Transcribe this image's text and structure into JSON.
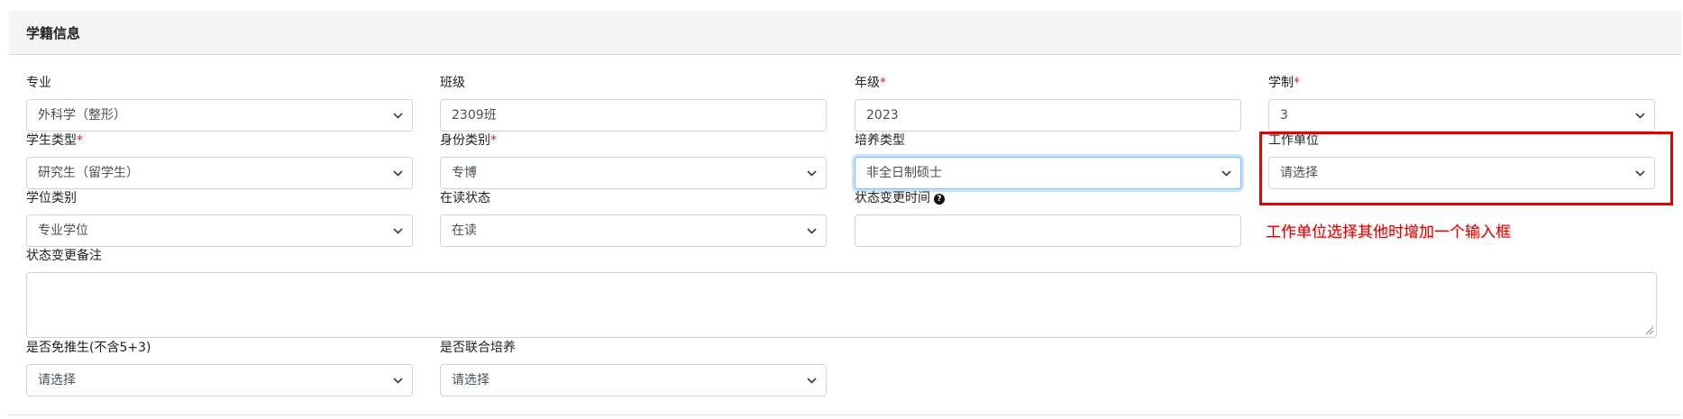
{
  "panel": {
    "title": "学籍信息"
  },
  "fields": {
    "major": {
      "label": "专业",
      "value": "外科学（整形）"
    },
    "class": {
      "label": "班级",
      "value": "2309班"
    },
    "grade": {
      "label": "年级",
      "required": "*",
      "value": "2023"
    },
    "duration": {
      "label": "学制",
      "required": "*",
      "value": "3"
    },
    "student_type": {
      "label": "学生类型",
      "required": "*",
      "value": "研究生（留学生）"
    },
    "identity_type": {
      "label": "身份类别",
      "required": "*",
      "value": "专博"
    },
    "training_type": {
      "label": "培养类型",
      "value": "非全日制硕士"
    },
    "work_unit": {
      "label": "工作单位",
      "value": "请选择"
    },
    "degree_type": {
      "label": "学位类别",
      "value": "专业学位"
    },
    "study_status": {
      "label": "在读状态",
      "value": "在读"
    },
    "status_change_time": {
      "label": "状态变更时间",
      "help_icon": "?",
      "value": ""
    },
    "status_change_note": {
      "label": "状态变更备注",
      "value": ""
    },
    "exempt": {
      "label": "是否免推生(不含5+3)",
      "value": "请选择"
    },
    "joint_training": {
      "label": "是否联合培养",
      "value": "请选择"
    }
  },
  "annotation": {
    "text": "工作单位选择其他时增加一个输入框",
    "color": "#e00000"
  },
  "colors": {
    "required": "#e02020",
    "focus_border": "#80bdff",
    "highlight": "#e60000"
  }
}
